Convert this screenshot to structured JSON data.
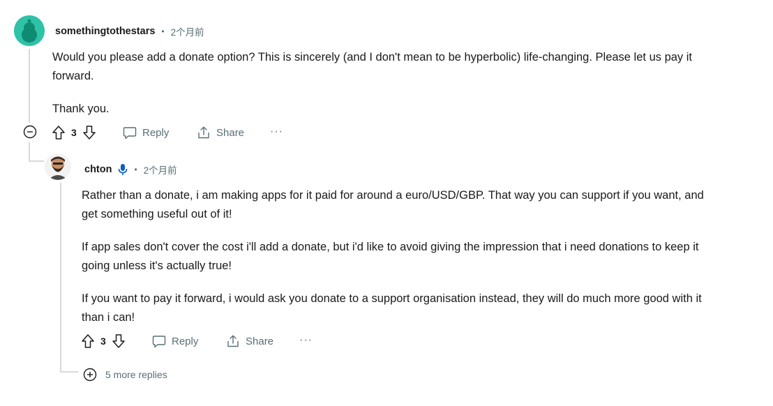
{
  "comment1": {
    "username": "somethingtothestars",
    "separator": "•",
    "time": "2个月前",
    "paragraphs": [
      "Would you please add a donate option? This is sincerely (and I don't mean to be hyperbolic) life-changing. Please let us pay it forward.",
      "Thank you."
    ],
    "votes": "3",
    "reply_label": "Reply",
    "share_label": "Share",
    "more_label": "···",
    "avatar_color": "#2ec3a7"
  },
  "comment2": {
    "username": "chton",
    "separator": "•",
    "time": "2个月前",
    "paragraphs": [
      "Rather than a donate, i am making apps for it paid for around a euro/USD/GBP. That way you can support if you want, and get something useful out of it!",
      "If app sales don't cover the cost i'll add a donate, but i'd like to avoid giving the impression that i need donations to keep it going unless it's actually true!",
      "If you want to pay it forward, i would ask you donate to a support organisation instead, they will do much more good with it than i can!"
    ],
    "votes": "3",
    "reply_label": "Reply",
    "share_label": "Share",
    "more_label": "···",
    "mod_badge_color": "#0a5fc4"
  },
  "more_replies": {
    "label": "5 more replies"
  },
  "colors": {
    "meta_gray": "#576f76",
    "thread_line": "#d7d9dc"
  }
}
